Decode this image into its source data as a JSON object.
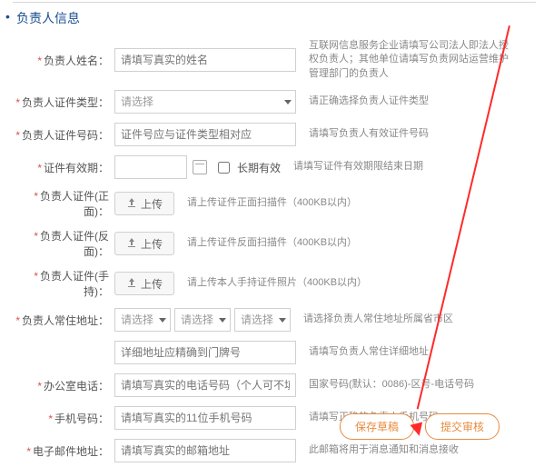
{
  "section_title": "负责人信息",
  "labels": {
    "name": "负责人姓名：",
    "id_type": "负责人证件类型：",
    "id_number": "负责人证件号码：",
    "validity": "证件有效期：",
    "id_front": "负责人证件(正面)：",
    "id_back": "负责人证件(反面)：",
    "id_hand": "负责人证件(手持)：",
    "address": "负责人常住地址：",
    "office_tel": "办公室电话：",
    "mobile": "手机号码：",
    "email": "电子邮件地址："
  },
  "placeholders": {
    "name": "请填写真实的姓名",
    "id_number": "证件号应与证件类型相对应",
    "addr_detail": "详细地址应精确到门牌号",
    "office_tel": "请填写真实的电话号码（个人可不填）",
    "mobile": "请填写真实的11位手机号码",
    "email": "请填写真实的邮箱地址"
  },
  "select": {
    "please": "请选择"
  },
  "checkbox": {
    "long_term": "长期有效"
  },
  "upload": {
    "label": "上传"
  },
  "hints": {
    "name": "互联网信息服务企业请填写公司法人即法人授权负责人；其他单位请填写负责网站运营维护管理部门的负责人",
    "id_type": "请正确选择负责人证件类型",
    "id_number": "请填写负责人有效证件号码",
    "validity": "请填写证件有效期限结束日期",
    "id_front": "请上传证件正面扫描件（400KB以内）",
    "id_back": "请上传证件反面扫描件（400KB以内）",
    "id_hand": "请上传本人手持证件照片（400KB以内）",
    "address_sel": "请选择负责人常住地址所属省市区",
    "addr_detail": "请填写负责人常住详细地址",
    "office_tel": "国家号码(默认：0086)-区号-电话号码",
    "mobile": "请填写正确的负责人手机号码",
    "email": "此邮箱将用于消息通知和消息接收"
  },
  "buttons": {
    "save_draft": "保存草稿",
    "submit": "提交审核"
  }
}
